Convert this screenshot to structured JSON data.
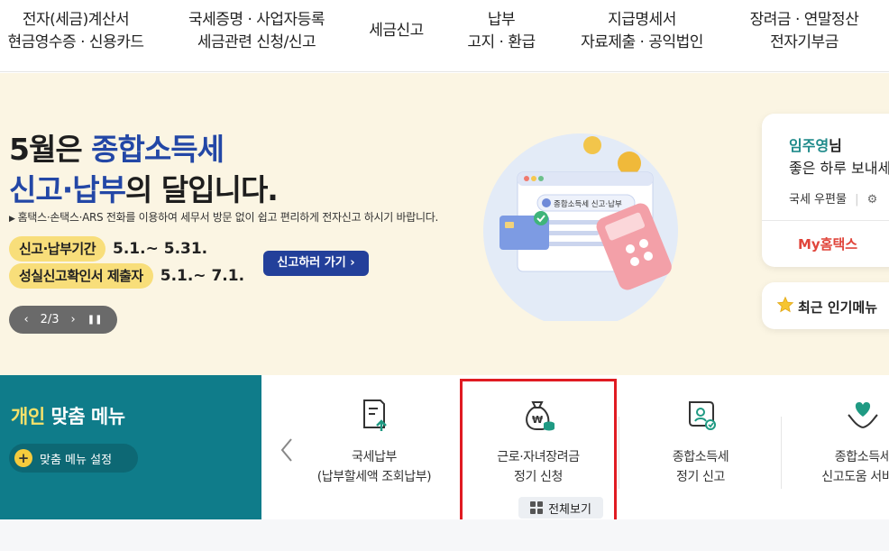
{
  "nav": [
    {
      "line1": "전자(세금)계산서",
      "line2": "현금영수증 · 신용카드"
    },
    {
      "line1": "국세증명 · 사업자등록",
      "line2": "세금관련 신청/신고"
    },
    {
      "line1": "세금신고",
      "line2": ""
    },
    {
      "line1": "납부",
      "line2": "고지 · 환급"
    },
    {
      "line1": "지급명세서",
      "line2": "자료제출 · 공익법인"
    },
    {
      "line1": "장려금 · 연말정산",
      "line2": "전자기부금"
    }
  ],
  "hero": {
    "title_line1_a": "5월은 ",
    "title_line1_b": "종합소득세",
    "title_line2_a": "신고",
    "title_line2_sep": "·",
    "title_line2_b": "납부",
    "title_line2_c": "의 달입니다.",
    "desc": "홈택스·손택스·ARS 전화를 이용하여 세무서 방문 없이 쉽고 편리하게 전자신고 하시기 바랍니다.",
    "period1_label": "신고·납부기간",
    "period1_value": "5.1.~ 5.31.",
    "period2_label": "성실신고확인서 제출자",
    "period2_value": "5.1.~ 7.1.",
    "go_button": "신고하러 가기 ›",
    "illust_text": "종합소득세 신고·납부",
    "slider": {
      "prev": "‹",
      "page": "2/3",
      "next": "›",
      "pause": "❚❚"
    }
  },
  "user_card": {
    "name": "임주영",
    "suffix": "님",
    "greeting": "좋은 하루 보내세요",
    "mailbox": "국세 우편물",
    "my_hometax": "My홈택스",
    "popular_menu": "최근 인기메뉴"
  },
  "custom_menu": {
    "title_a": "개인",
    "title_b": " 맞춤 메뉴",
    "setting": "맞춤 메뉴 설정",
    "view_all": "전체보기",
    "items": [
      {
        "line1": "국세납부",
        "line2": "(납부할세액 조회납부)",
        "icon": "document-upload-icon"
      },
      {
        "line1": "근로·자녀장려금",
        "line2": "정기 신청",
        "icon": "money-bag-icon"
      },
      {
        "line1": "종합소득세",
        "line2": "정기 신고",
        "icon": "certificate-icon"
      },
      {
        "line1": "종합소득세",
        "line2": "신고도움 서비스",
        "icon": "heart-hands-icon"
      }
    ]
  },
  "colors": {
    "accent_navy": "#23409a",
    "teal": "#0f7c8a",
    "highlight_red": "#e01b22",
    "pill_yellow": "#f8de7a"
  }
}
